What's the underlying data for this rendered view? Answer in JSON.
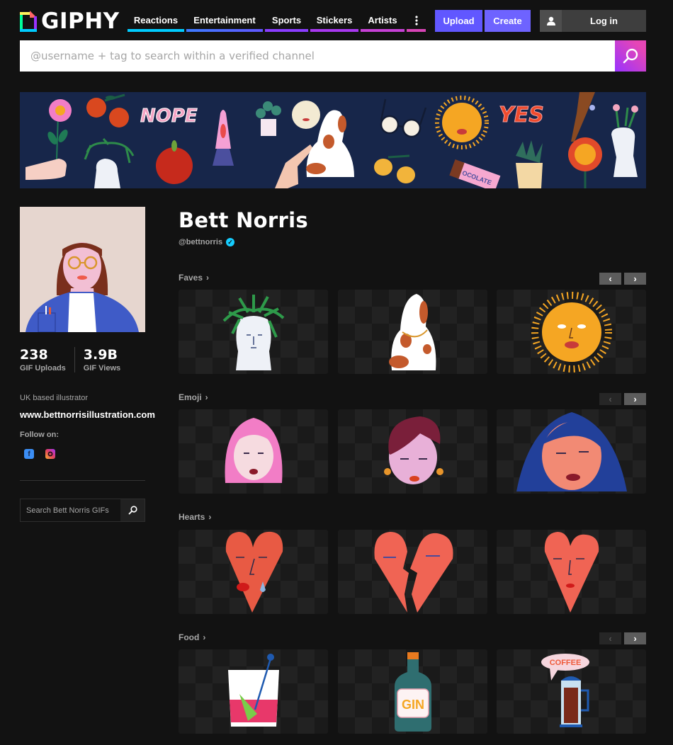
{
  "header": {
    "logo_text": "GIPHY",
    "nav": [
      {
        "label": "Reactions",
        "color": "#00ccff"
      },
      {
        "label": "Entertainment",
        "color": "#3d7bff"
      },
      {
        "label": "Sports",
        "color": "#9933ff"
      },
      {
        "label": "Stickers",
        "color": "#a838f0"
      },
      {
        "label": "Artists",
        "color": "#c640d6"
      }
    ],
    "more_icon": "vertical-ellipsis-icon",
    "upload_label": "Upload",
    "create_label": "Create",
    "login_label": "Log in",
    "login_icon": "user-icon",
    "search_placeholder": "@username + tag to search within a verified channel",
    "search_icon": "search-icon"
  },
  "banner": {
    "stickers": [
      "flower-in-hand",
      "oranges",
      "NOPE",
      "bust-with-fern",
      "apple",
      "lava-lamp",
      "potted-plant",
      "moon-face",
      "pointing-hand",
      "spaniel-dog",
      "glasses",
      "lemons",
      "sun-face",
      "chocolate-bar",
      "YES",
      "vase-plant",
      "pointing-finger",
      "flower-face",
      "bust-with-flowers"
    ],
    "nope_text": "NOPE",
    "yes_text": "YES"
  },
  "profile": {
    "name": "Bett Norris",
    "handle": "@bettnorris",
    "verified": true,
    "stats": [
      {
        "value": "238",
        "label": "GIF Uploads"
      },
      {
        "value": "3.9B",
        "label": "GIF Views"
      }
    ],
    "bio": "UK based illustrator",
    "website": "www.bettnorrisillustration.com",
    "follow_label": "Follow on:",
    "social": [
      "facebook",
      "instagram"
    ],
    "channel_search_placeholder": "Search Bett Norris GIFs"
  },
  "sections": [
    {
      "title": "Faves",
      "prev_enabled": true,
      "next_enabled": true,
      "items": [
        "bust-with-fern",
        "spaniel-dog",
        "sun-face"
      ]
    },
    {
      "title": "Emoji",
      "prev_enabled": false,
      "next_enabled": true,
      "items": [
        "pink-hair-girl",
        "short-hair-woman",
        "blue-hair-woman"
      ]
    },
    {
      "title": "Hearts",
      "prev_enabled": false,
      "next_enabled": false,
      "items": [
        "crying-heart",
        "broken-heart",
        "smiling-heart"
      ]
    },
    {
      "title": "Food",
      "prev_enabled": false,
      "next_enabled": true,
      "items": [
        "cocktail-glass",
        "gin-bottle",
        "coffee-press"
      ]
    }
  ],
  "food_labels": {
    "gin": "GIN",
    "coffee": "COFFEE"
  }
}
